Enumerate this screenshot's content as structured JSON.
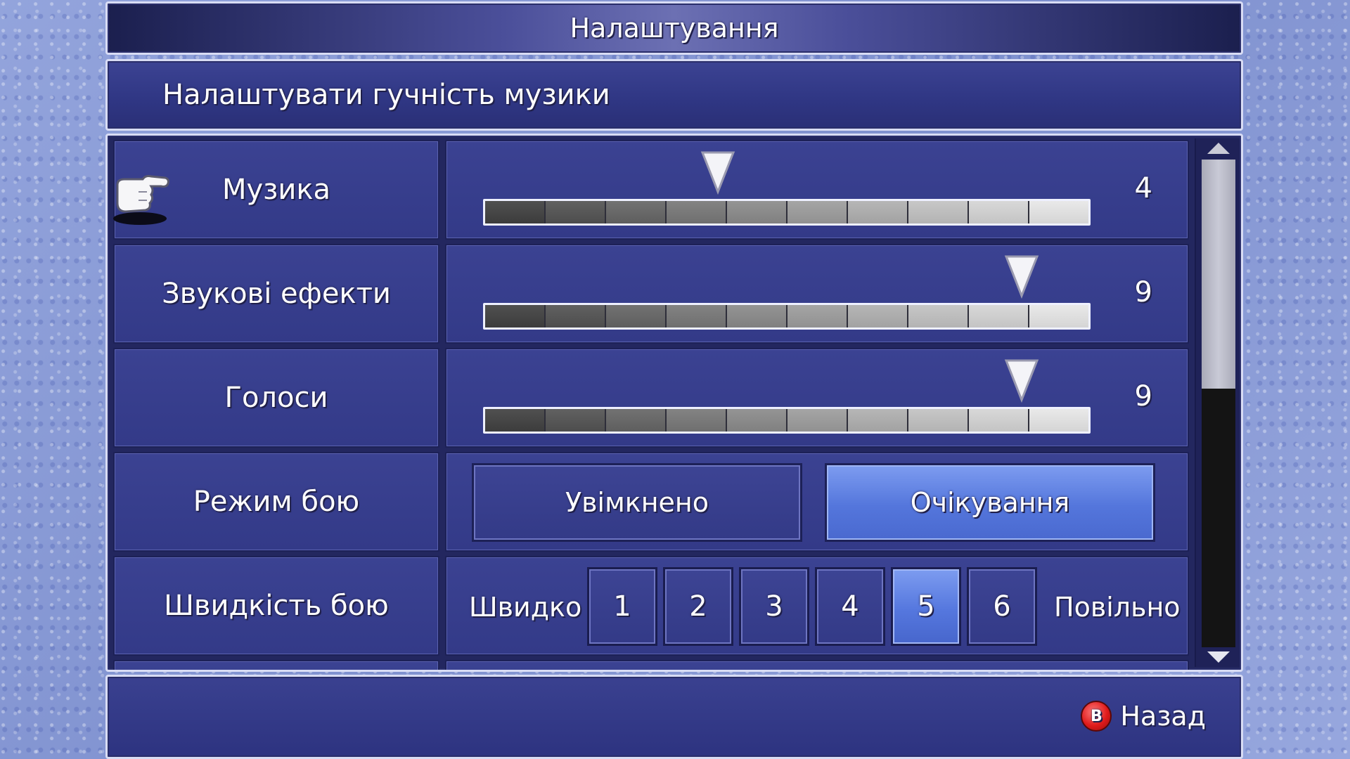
{
  "title": "Налаштування",
  "help_text": "Налаштувати гучність музики",
  "volume_rows": [
    {
      "label": "Музика",
      "level": "4",
      "level_fraction": 0.4
    },
    {
      "label": "Звукові ефекти",
      "level": "9",
      "level_fraction": 0.9
    },
    {
      "label": "Голоси",
      "level": "9",
      "level_fraction": 0.9
    }
  ],
  "battle_mode": {
    "label": "Режим бою",
    "options": [
      "Увімкнено",
      "Очікування"
    ],
    "selected_index": 1
  },
  "battle_speed": {
    "label": "Швидкість бою",
    "fast_label": "Швидко",
    "slow_label": "Повільно",
    "options": [
      "1",
      "2",
      "3",
      "4",
      "5",
      "6"
    ],
    "selected": "5"
  },
  "scroll_fraction": 0.47,
  "footer": {
    "back_button_glyph": "B",
    "back_label": "Назад"
  },
  "colors": {
    "accent": "#5a7ae0",
    "back_button": "#e01b1b"
  },
  "icons": [
    "pointing-hand-icon",
    "scroll-up-arrow-icon",
    "scroll-down-arrow-icon",
    "slider-pointer-icon"
  ]
}
